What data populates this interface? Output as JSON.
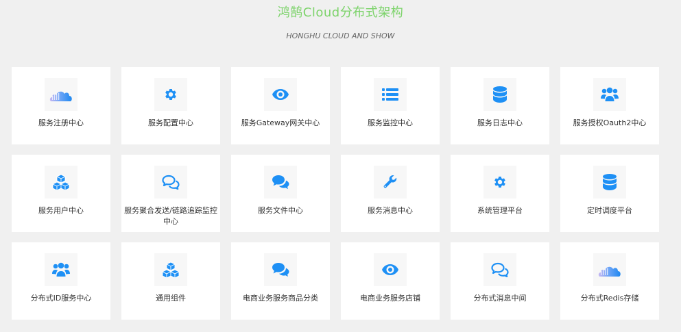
{
  "header": {
    "title": "鸿鹄Cloud分布式架构",
    "subtitle": "HONGHU CLOUD AND SHOW"
  },
  "colors": {
    "title_green": "#7cd36a",
    "icon_blue": "#1e90f5",
    "card_bg": "#ffffff",
    "page_bg": "#f0f0f0"
  },
  "cards": [
    {
      "label": "服务注册中心",
      "icon": "cloud-icon"
    },
    {
      "label": "服务配置中心",
      "icon": "gear-icon"
    },
    {
      "label": "服务Gateway网关中心",
      "icon": "eye-icon"
    },
    {
      "label": "服务监控中心",
      "icon": "list-icon"
    },
    {
      "label": "服务日志中心",
      "icon": "database-icon"
    },
    {
      "label": "服务授权Oauth2中心",
      "icon": "users-icon"
    },
    {
      "label": "服务用户中心",
      "icon": "cubes-icon"
    },
    {
      "label": "服务聚合发送/链路追踪监控中心",
      "icon": "comments-outline-icon"
    },
    {
      "label": "服务文件中心",
      "icon": "comments-icon"
    },
    {
      "label": "服务消息中心",
      "icon": "wrench-icon"
    },
    {
      "label": "系统管理平台",
      "icon": "gear-icon"
    },
    {
      "label": "定时调度平台",
      "icon": "database-icon"
    },
    {
      "label": "分布式ID服务中心",
      "icon": "users-icon"
    },
    {
      "label": "通用组件",
      "icon": "cubes-icon"
    },
    {
      "label": "电商业务服务商品分类",
      "icon": "comments-icon"
    },
    {
      "label": "电商业务服务店铺",
      "icon": "eye-icon"
    },
    {
      "label": "分布式消息中间",
      "icon": "comments-outline-icon"
    },
    {
      "label": "分布式Redis存储",
      "icon": "cloud-icon"
    }
  ]
}
